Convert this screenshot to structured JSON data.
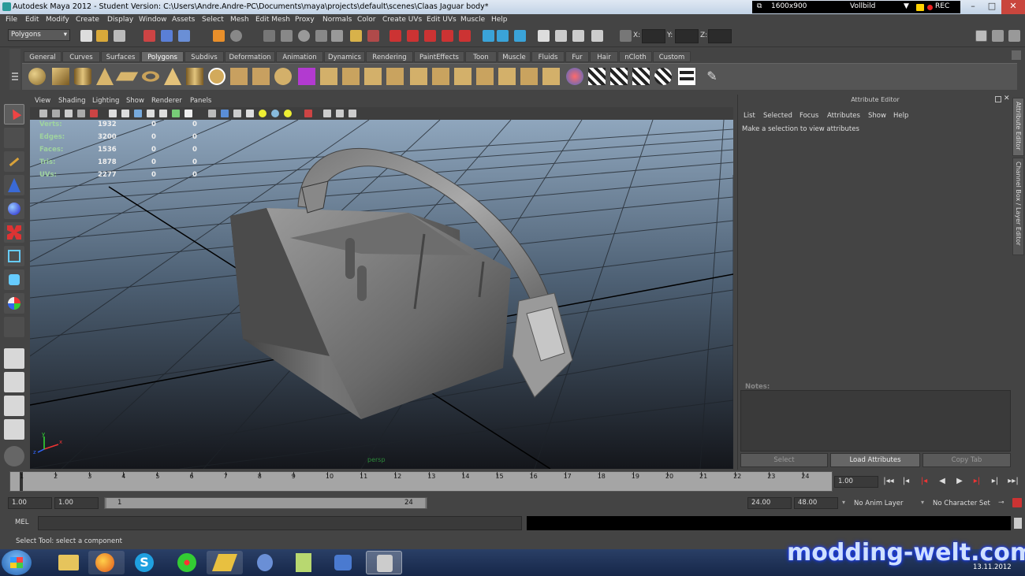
{
  "window": {
    "title": "Autodesk Maya 2012 - Student Version: C:\\Users\\Andre.Andre-PC\\Documents\\maya\\projects\\default\\scenes\\Claas Jaguar body*",
    "controls": [
      "–",
      "□",
      "✕"
    ]
  },
  "recorder": {
    "resolution": "1600x900",
    "mode": "Vollbild",
    "rec": "REC"
  },
  "menu": [
    "File",
    "Edit",
    "Modify",
    "Create",
    "Display",
    "Window",
    "Assets",
    "Select",
    "Mesh",
    "Edit Mesh",
    "Proxy",
    "Normals",
    "Color",
    "Create UVs",
    "Edit UVs",
    "Muscle",
    "Help"
  ],
  "status_line": {
    "menu_set": "Polygons",
    "x_label": "X:",
    "y_label": "Y:",
    "z_label": "Z:"
  },
  "shelf_tabs": [
    "General",
    "Curves",
    "Surfaces",
    "Polygons",
    "Subdivs",
    "Deformation",
    "Animation",
    "Dynamics",
    "Rendering",
    "PaintEffects",
    "Toon",
    "Muscle",
    "Fluids",
    "Fur",
    "Hair",
    "nCloth",
    "Custom"
  ],
  "active_shelf_tab": "Polygons",
  "viewport": {
    "menu": [
      "View",
      "Shading",
      "Lighting",
      "Show",
      "Renderer",
      "Panels"
    ],
    "camera_label": "persp",
    "hud": [
      {
        "label": "Verts:",
        "total": "1932",
        "selected": "0",
        "tweak": "0"
      },
      {
        "label": "Edges:",
        "total": "3200",
        "selected": "0",
        "tweak": "0"
      },
      {
        "label": "Faces:",
        "total": "1536",
        "selected": "0",
        "tweak": "0"
      },
      {
        "label": "Tris:",
        "total": "1878",
        "selected": "0",
        "tweak": "0"
      },
      {
        "label": "UVs:",
        "total": "2277",
        "selected": "0",
        "tweak": "0"
      }
    ],
    "axis": {
      "x": "x",
      "y": "y",
      "z": "z"
    }
  },
  "attribute_editor": {
    "title": "Attribute Editor",
    "menu": [
      "List",
      "Selected",
      "Focus",
      "Attributes",
      "Show",
      "Help"
    ],
    "message": "Make a selection to view attributes",
    "notes_label": "Notes:",
    "buttons": [
      "Select",
      "Load Attributes",
      "Copy Tab"
    ]
  },
  "side_tabs": [
    "Attribute Editor",
    "Channel Box / Layer Editor"
  ],
  "timeline": {
    "frames": [
      "1",
      "2",
      "3",
      "4",
      "5",
      "6",
      "7",
      "8",
      "9",
      "10",
      "11",
      "12",
      "13",
      "14",
      "15",
      "16",
      "17",
      "18",
      "19",
      "20",
      "21",
      "22",
      "23",
      "24"
    ],
    "current_frame": "1.00",
    "range_start": "1.00",
    "range_start_inner": "1.00",
    "slider_start": "1",
    "slider_end": "24",
    "end_inner": "24.00",
    "end_outer": "48.00",
    "anim_layer": "No Anim Layer",
    "character_set": "No Character Set"
  },
  "command_line": {
    "label": "MEL"
  },
  "help_line": "Select Tool: select a component",
  "watermark": "modding-welt.com",
  "clock": {
    "date": "13.11.2012"
  }
}
